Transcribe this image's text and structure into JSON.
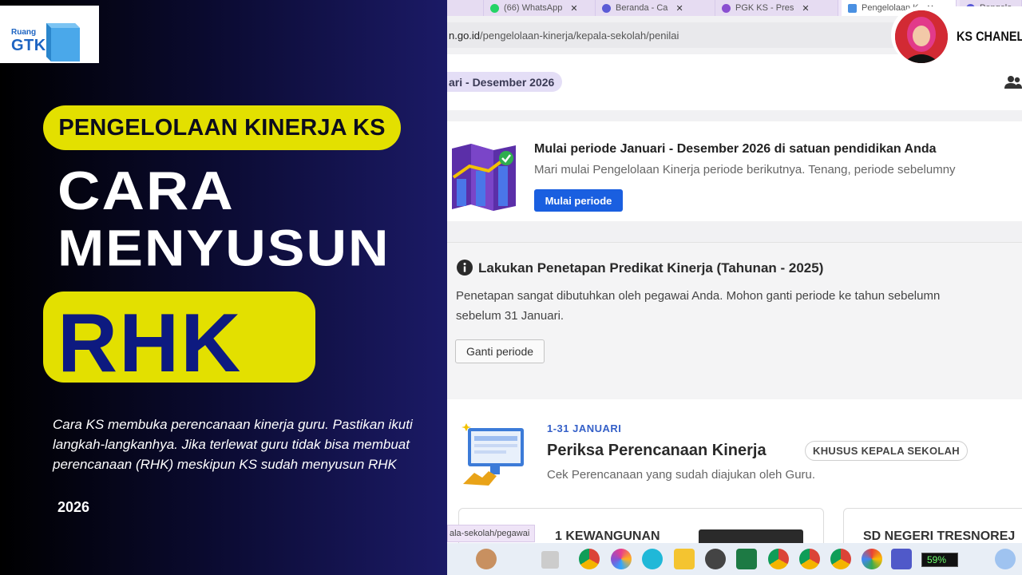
{
  "logo": {
    "small": "Ruang",
    "big": "GTK"
  },
  "promo": {
    "topic": "PENGELOLAAN KINERJA KS",
    "headline_line1": "CARA",
    "headline_line2": "MENYUSUN",
    "keyword": "RHK",
    "description": "Cara KS membuka perencanaan kinerja guru. Pastikan ikuti langkah-langkanhya. Jika terlewat guru tidak bisa membuat perencanaan (RHK) meskipun KS sudah menyusun RHK",
    "year": "2026",
    "colors": {
      "accent_yellow": "#e3e000",
      "rhk_text": "#0d1a80",
      "bg_dark": "#0a0a2e"
    }
  },
  "channel": {
    "name": "KS CHANEL"
  },
  "browser": {
    "tabs": [
      {
        "label": "(66) WhatsApp",
        "icon": "whatsapp-icon"
      },
      {
        "label": "Beranda - Ca",
        "icon": "chrome-icon"
      },
      {
        "label": "PGK KS - Pres",
        "icon": "puzzle-icon"
      },
      {
        "label": "Pengelolaan K",
        "icon": "page-icon"
      },
      {
        "label": "Pengelo",
        "icon": "chrome-icon"
      }
    ],
    "url_domain": "n.go.id",
    "url_path": "/pengelolaan-kinerja/kepala-sekolah/penilai",
    "status_url": "ala-sekolah/pegawai"
  },
  "page": {
    "period_label": "ari - Desember 2026",
    "start_card": {
      "title": "Mulai periode Januari - Desember 2026 di satuan pendidikan Anda",
      "subtitle": "Mari mulai Pengelolaan Kinerja periode berikutnya. Tenang, periode sebelumny",
      "button": "Mulai periode"
    },
    "notice_card": {
      "title": "Lakukan Penetapan Predikat Kinerja (Tahunan - 2025)",
      "body_line1": "Penetapan sangat dibutuhkan oleh pegawai Anda. Mohon ganti periode ke tahun sebelumn",
      "body_line2": "sebelum 31 Januari.",
      "button": "Ganti periode"
    },
    "review_card": {
      "date": "1-31 JANUARI",
      "title": "Periksa Perencanaan Kinerja",
      "badge": "KHUSUS KEPALA SEKOLAH",
      "subtitle": "Cek Perencanaan yang sudah diajukan oleh Guru."
    },
    "schools": [
      "1 KEWANGUNAN",
      "SD NEGERI TRESNOREJ"
    ]
  },
  "taskbar": {
    "battery": "59%"
  }
}
